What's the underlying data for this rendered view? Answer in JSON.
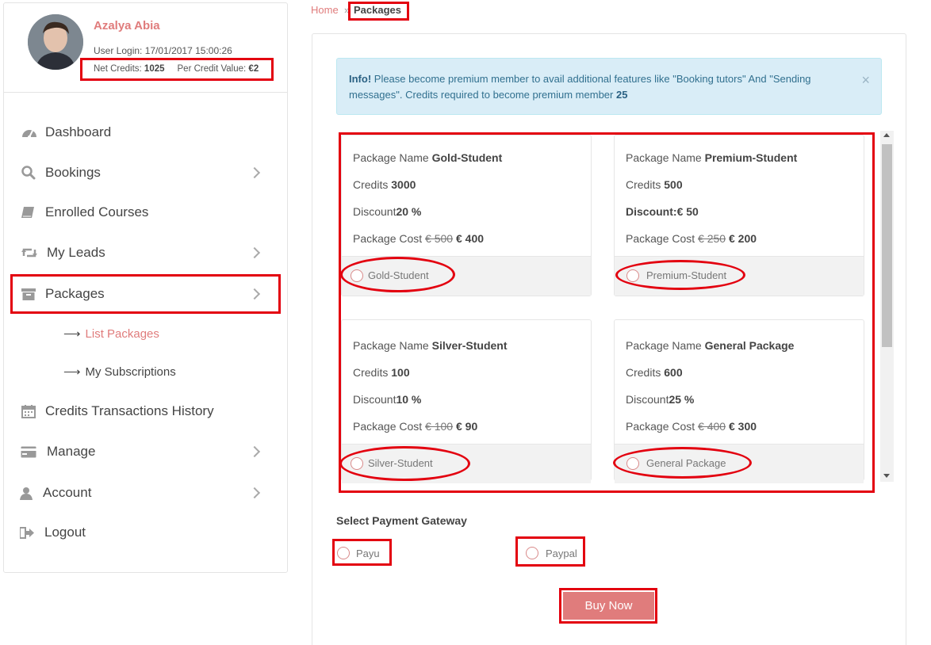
{
  "profile": {
    "name": "Azalya Abia",
    "user_login": "User Login: 17/01/2017 15:00:26",
    "net_credits_label": "Net Credits:",
    "net_credits_value": "1025",
    "per_credit_label": "Per Credit Value:",
    "per_credit_value": "€2"
  },
  "nav": {
    "items": [
      {
        "label": "Dashboard",
        "icon": "dashboard-icon"
      },
      {
        "label": "Bookings",
        "icon": "search-icon"
      },
      {
        "label": "Enrolled Courses",
        "icon": "book-icon"
      },
      {
        "label": "My Leads",
        "icon": "retweet-icon"
      },
      {
        "label": "Packages",
        "icon": "archive-icon"
      },
      {
        "label": "Credits Transactions History",
        "icon": "calendar-icon"
      },
      {
        "label": "Manage",
        "icon": "credit-card-icon"
      },
      {
        "label": "Account",
        "icon": "user-icon"
      },
      {
        "label": "Logout",
        "icon": "sign-out-icon"
      }
    ],
    "sub_items": [
      {
        "label": "List Packages",
        "active": true
      },
      {
        "label": "My Subscriptions",
        "active": false
      }
    ]
  },
  "breadcrumb": {
    "home": "Home",
    "sep": "»",
    "current": "Packages"
  },
  "info": {
    "strong": "Info!",
    "text": " Please become premium member to avail additional features like \"Booking tutors\" And \"Sending messages\". Credits required to become premium member ",
    "credits": "25",
    "close": "×"
  },
  "packages": [
    {
      "name_label": "Package Name",
      "name": "Gold-Student",
      "credits_label": "Credits",
      "credits": "3000",
      "discount_label": "Discount",
      "discount": "20 %",
      "cost_label": "Package Cost",
      "old_price": "€ 500",
      "new_price": "€ 400",
      "radio_label": "Gold-Student"
    },
    {
      "name_label": "Package Name",
      "name": "Premium-Student",
      "credits_label": "Credits",
      "credits": "500",
      "discount_label": "Discount:",
      "discount": "€ 50",
      "cost_label": "Package Cost",
      "old_price": "€ 250",
      "new_price": "€ 200",
      "radio_label": "Premium-Student"
    },
    {
      "name_label": "Package Name",
      "name": "Silver-Student",
      "credits_label": "Credits",
      "credits": "100",
      "discount_label": "Discount",
      "discount": "10 %",
      "cost_label": "Package Cost",
      "old_price": "€ 100",
      "new_price": "€ 90",
      "radio_label": "Silver-Student"
    },
    {
      "name_label": "Package Name",
      "name": "General Package",
      "credits_label": "Credits",
      "credits": "600",
      "discount_label": "Discount",
      "discount": "25 %",
      "cost_label": "Package Cost",
      "old_price": "€ 400",
      "new_price": "€ 300",
      "radio_label": "General Package"
    }
  ],
  "gateway": {
    "title": "Select Payment Gateway",
    "options": [
      "Payu",
      "Paypal"
    ]
  },
  "buy_button": "Buy Now",
  "colors": {
    "accent": "#e07c7c",
    "highlight": "#e3000f",
    "info_bg": "#d9edf7"
  }
}
